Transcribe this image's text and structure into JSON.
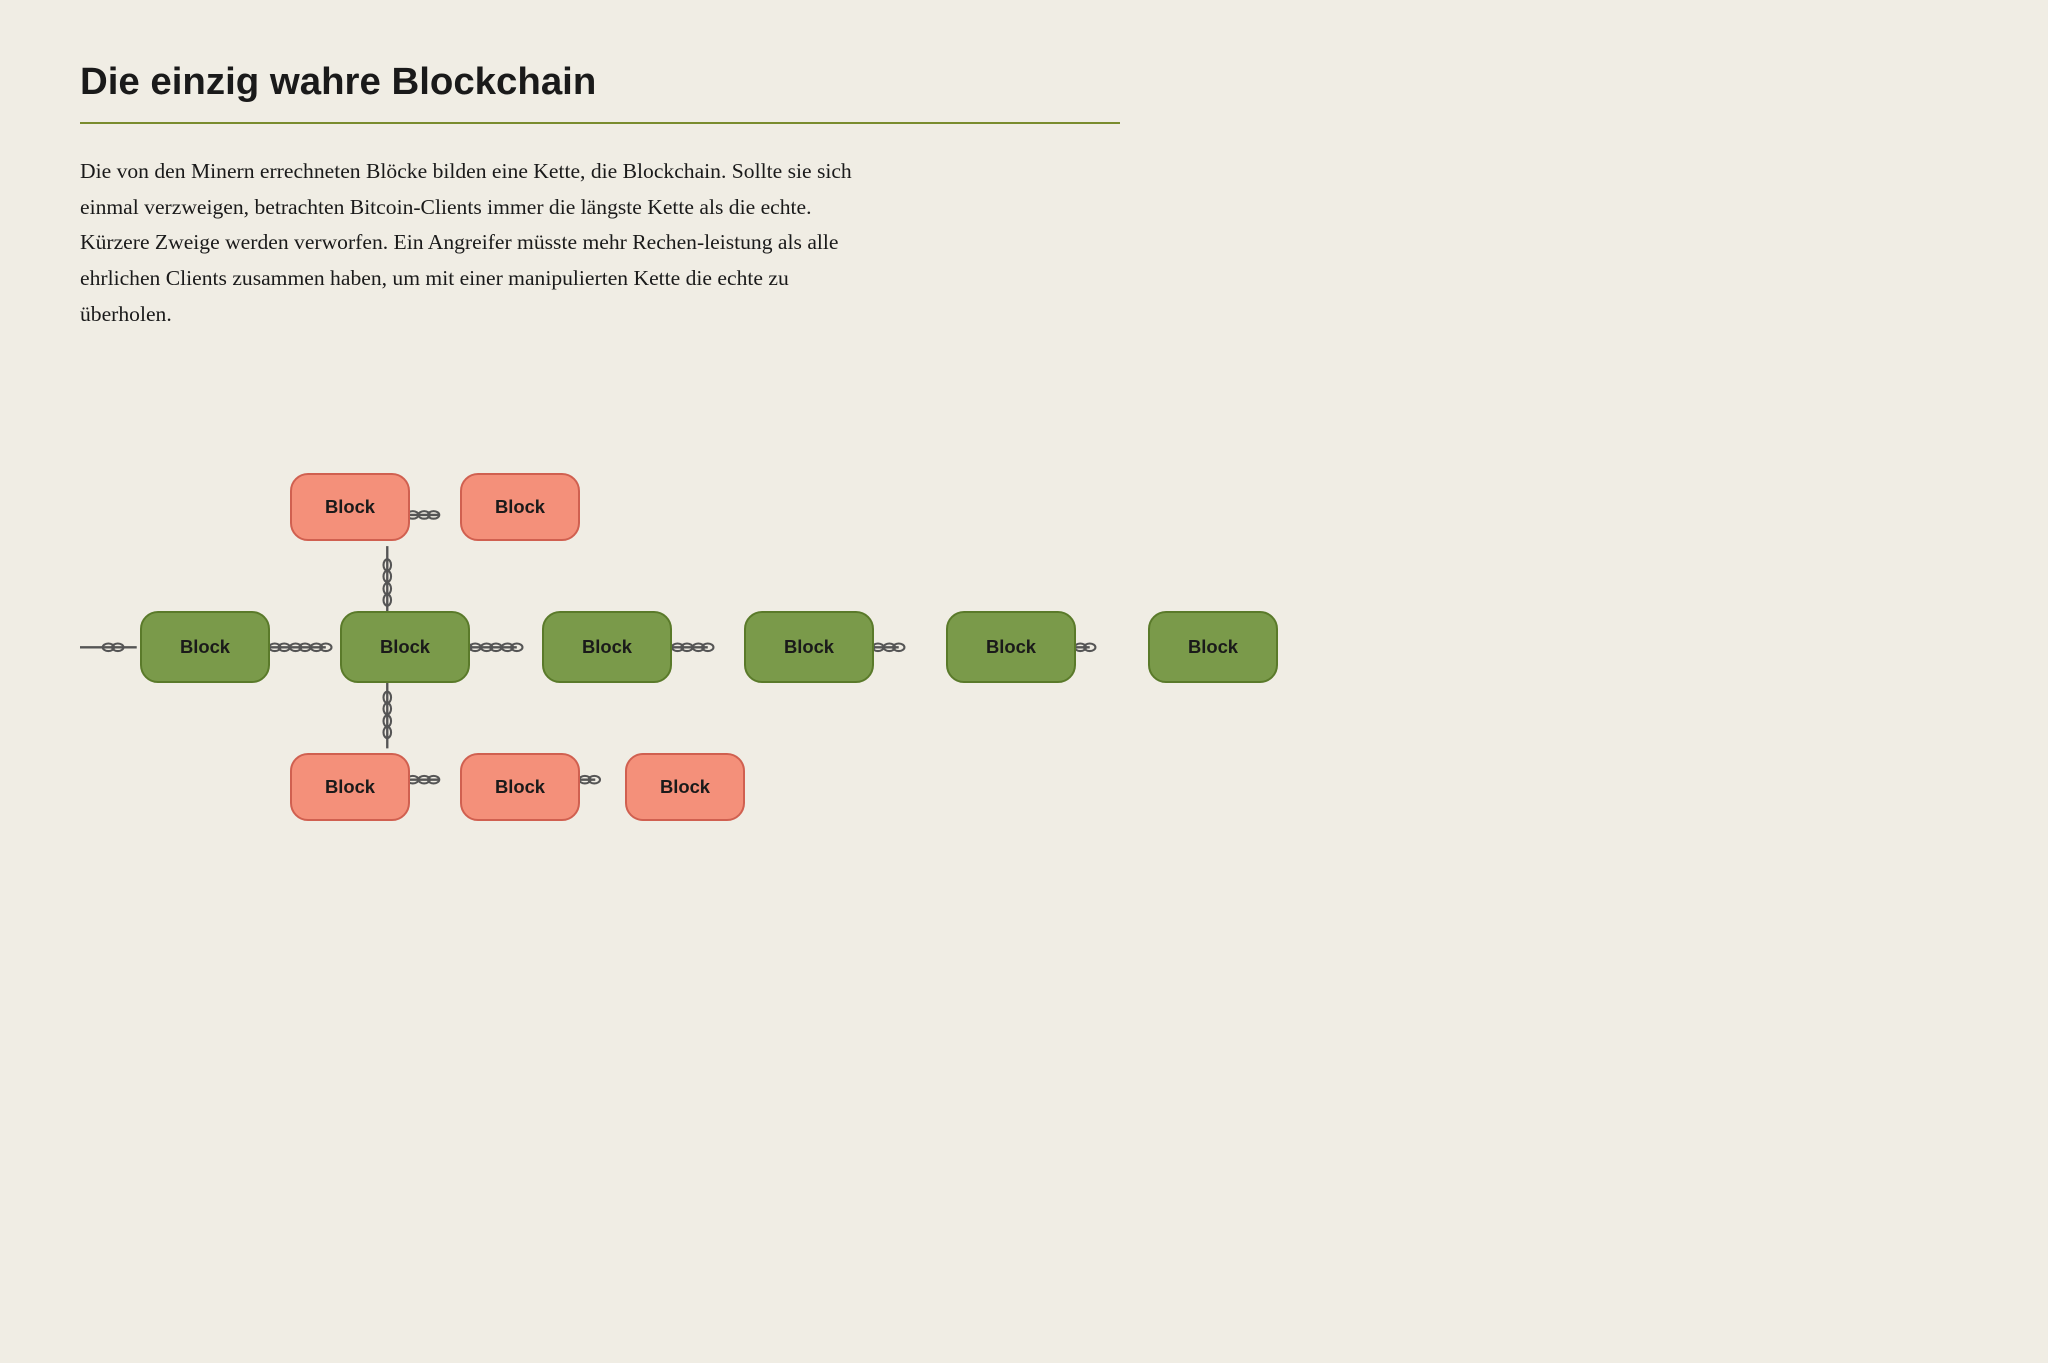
{
  "page": {
    "title": "Die einzig wahre Blockchain",
    "description": "Die von den Minern errechneten Blöcke bilden eine Kette, die Blockchain. Sollte sie sich einmal verzweigen, betrachten Bitcoin-Clients immer die längste Kette als die echte. Kürzere Zweige werden verworfen. Ein Angreifer müsste mehr Rechen-leistung als alle ehrlichen Clients zusammen haben, um mit einer manipulierten Kette die echte zu überholen."
  },
  "diagram": {
    "green_blocks": [
      {
        "label": "Block",
        "id": "g1"
      },
      {
        "label": "Block",
        "id": "g2"
      },
      {
        "label": "Block",
        "id": "g3"
      },
      {
        "label": "Block",
        "id": "g4"
      },
      {
        "label": "Block",
        "id": "g5"
      },
      {
        "label": "Block",
        "id": "g6"
      }
    ],
    "red_top_blocks": [
      {
        "label": "Block",
        "id": "r1"
      },
      {
        "label": "Block",
        "id": "r2"
      }
    ],
    "red_bottom_blocks": [
      {
        "label": "Block",
        "id": "r3"
      },
      {
        "label": "Block",
        "id": "r4"
      },
      {
        "label": "Block",
        "id": "r5"
      }
    ]
  }
}
